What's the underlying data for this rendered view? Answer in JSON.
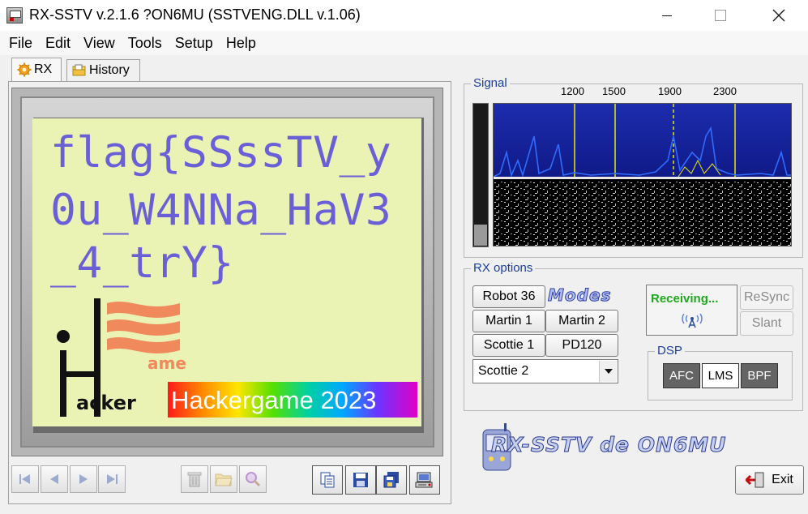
{
  "window": {
    "title": "RX-SSTV v.2.1.6 ?ON6MU (SSTVENG.DLL v.1.06)"
  },
  "menu": [
    "File",
    "Edit",
    "View",
    "Tools",
    "Setup",
    "Help"
  ],
  "tabs": [
    {
      "label": "RX",
      "icon": "gear-icon",
      "active": true
    },
    {
      "label": "History",
      "icon": "folder-icon",
      "active": false
    }
  ],
  "image": {
    "flag_lines": [
      "flag{SSssTV_y",
      "0u_W4NNa_HaV3",
      "_4_trY}"
    ],
    "banner_text": "Hackergame 2023",
    "logo_text": "acker",
    "logo_text2": "ame"
  },
  "signal": {
    "label": "Signal",
    "freq_ticks": [
      "1200",
      "1500",
      "1900",
      "2300"
    ]
  },
  "rx_options": {
    "label": "RX options",
    "modes_logo": "Modes",
    "modes": [
      "Robot 36",
      "Martin 1",
      "Martin 2",
      "Scottie 1",
      "PD120"
    ],
    "selected_mode": "Scottie 2",
    "status": "Receiving...",
    "resync_label": "ReSync",
    "slant_label": "Slant"
  },
  "dsp": {
    "label": "DSP",
    "buttons": [
      {
        "label": "AFC",
        "on": true
      },
      {
        "label": "LMS",
        "on": false
      },
      {
        "label": "BPF",
        "on": true
      }
    ]
  },
  "brand": "RX-SSTV de ON6MU",
  "exit_label": "Exit",
  "colors": {
    "flag_text": "#6b5fd8",
    "receiving": "#1fa81f",
    "image_bg": "#eaf2b4",
    "group_label": "#1c3f9c"
  }
}
